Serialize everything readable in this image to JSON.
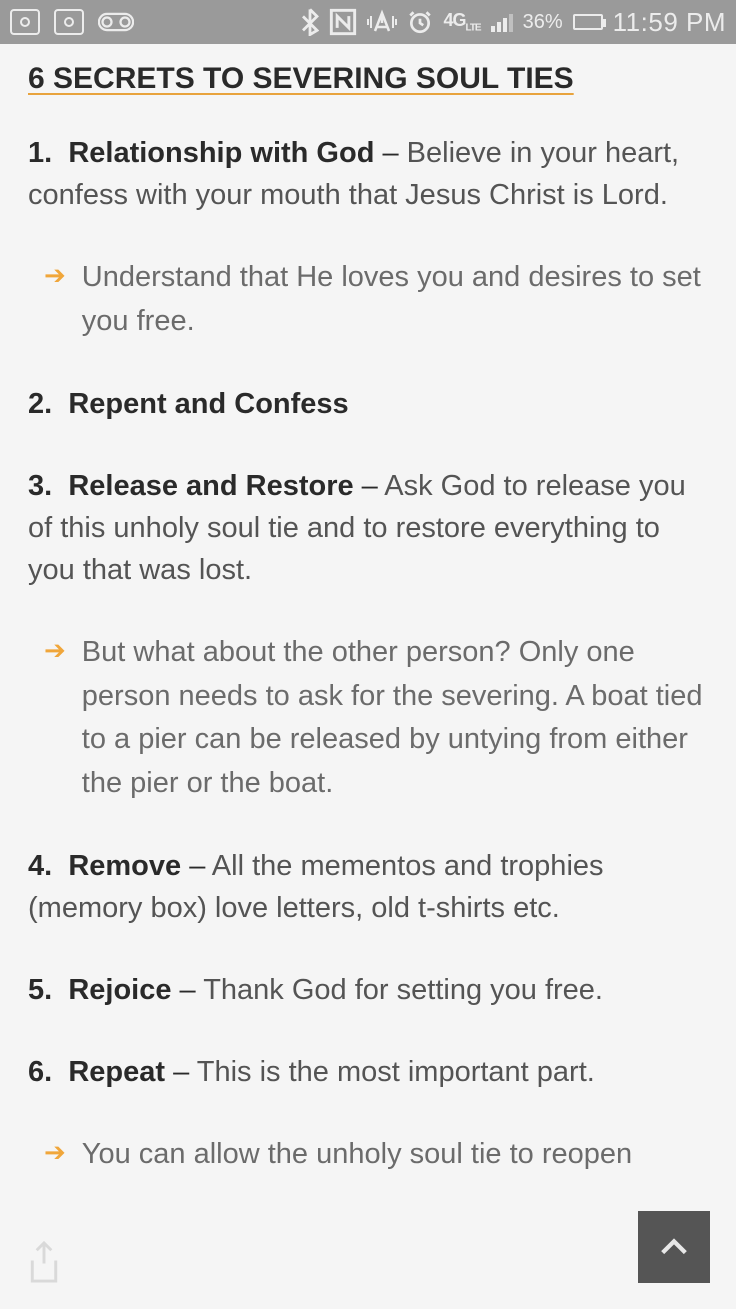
{
  "statusbar": {
    "battery_pct": "36%",
    "clock": "11:59 PM",
    "network": "4G",
    "network_sub": "LTE"
  },
  "article": {
    "title": "6 SECRETS TO SEVERING SOUL TIES",
    "items": [
      {
        "num": "1.",
        "lead": "Relationship with God",
        "dash": " – ",
        "body": "Believe in your heart, confess with your mouth that Jesus Christ is Lord."
      },
      {
        "num": "2.",
        "lead": "Repent and Confess",
        "dash": "",
        "body": ""
      },
      {
        "num": "3.",
        "lead": "Release and Restore",
        "dash": " – ",
        "body": "Ask God to release you of this unholy soul tie and to restore everything to you that was lost."
      },
      {
        "num": "4.",
        "lead": "Remove",
        "dash": " – ",
        "body": "All the mementos and trophies (memory box) love letters, old t-shirts etc."
      },
      {
        "num": "5.",
        "lead": "Rejoice",
        "dash": " – ",
        "body": "Thank God for setting you free."
      },
      {
        "num": "6.",
        "lead": "Repeat",
        "dash": " – ",
        "body": "This is the most important part."
      }
    ],
    "subs": {
      "after1": "Understand that He loves you and desires to set you free.",
      "after3": "But what about the other person?  Only one person needs to ask for the severing.  A boat tied to a pier can be released by untying from either the pier or the boat.",
      "after6": "You can allow the unholy soul tie to reopen"
    }
  }
}
